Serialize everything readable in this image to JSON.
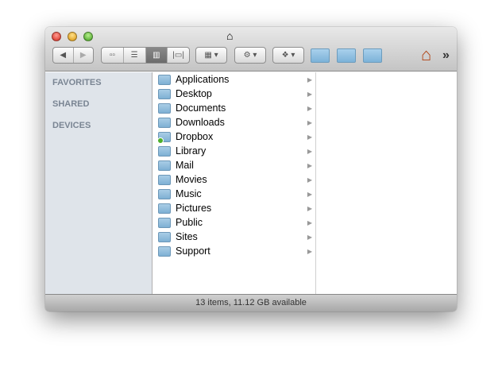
{
  "window": {
    "title_icon": "home-icon"
  },
  "toolbar": {
    "back": "◀",
    "forward": "▶",
    "views": [
      {
        "name": "icon-view",
        "glyph": "▫▫"
      },
      {
        "name": "list-view",
        "glyph": "☰"
      },
      {
        "name": "column-view",
        "glyph": "▥"
      },
      {
        "name": "coverflow-view",
        "glyph": "|▭|"
      }
    ],
    "arrange": "▦ ▾",
    "action": "⚙ ▾",
    "dropbox": "❖ ▾",
    "overflow": "»",
    "home": "⌂"
  },
  "sidebar": {
    "sections": [
      "FAVORITES",
      "SHARED",
      "DEVICES"
    ]
  },
  "column": {
    "items": [
      "Applications",
      "Desktop",
      "Documents",
      "Downloads",
      "Dropbox",
      "Library",
      "Mail",
      "Movies",
      "Music",
      "Pictures",
      "Public",
      "Sites",
      "Support"
    ]
  },
  "status": "13 items, 11.12 GB available"
}
